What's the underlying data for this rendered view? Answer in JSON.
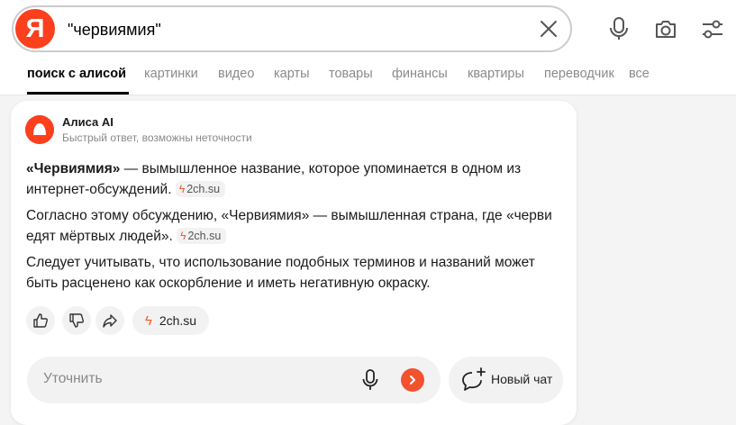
{
  "search": {
    "query": "\"червиямия\"",
    "logo_letter": "Я"
  },
  "tabs": [
    {
      "label": "поиск с алисой",
      "active": true
    },
    {
      "label": "картинки"
    },
    {
      "label": "видео"
    },
    {
      "label": "карты"
    },
    {
      "label": "товары"
    },
    {
      "label": "финансы"
    },
    {
      "label": "квартиры"
    },
    {
      "label": "переводчик"
    },
    {
      "label": "все"
    }
  ],
  "answer": {
    "title": "Алиса AI",
    "subtitle": "Быстрый ответ, возможны неточности",
    "p1_bold": "«Червиямия»",
    "p1_text": " — вымышленное название, которое упоминается в одном из интернет-обсуждений. ",
    "p2_text": "Согласно этому обсуждению, «Червиямия» — вымышленная страна, где «черви едят мёртвых людей». ",
    "p3_text": "Следует учитывать, что использование подобных терминов и названий может быть расценено как оскорбление и иметь негативную окраску.",
    "source": "2ch.su",
    "source_button": "2ch.su"
  },
  "refine": {
    "placeholder": "Уточнить"
  },
  "new_chat": {
    "label": "Новый чат"
  },
  "colors": {
    "brand": "#fc3f1d",
    "send": "#f2522e",
    "bolt": "#f05a28"
  }
}
